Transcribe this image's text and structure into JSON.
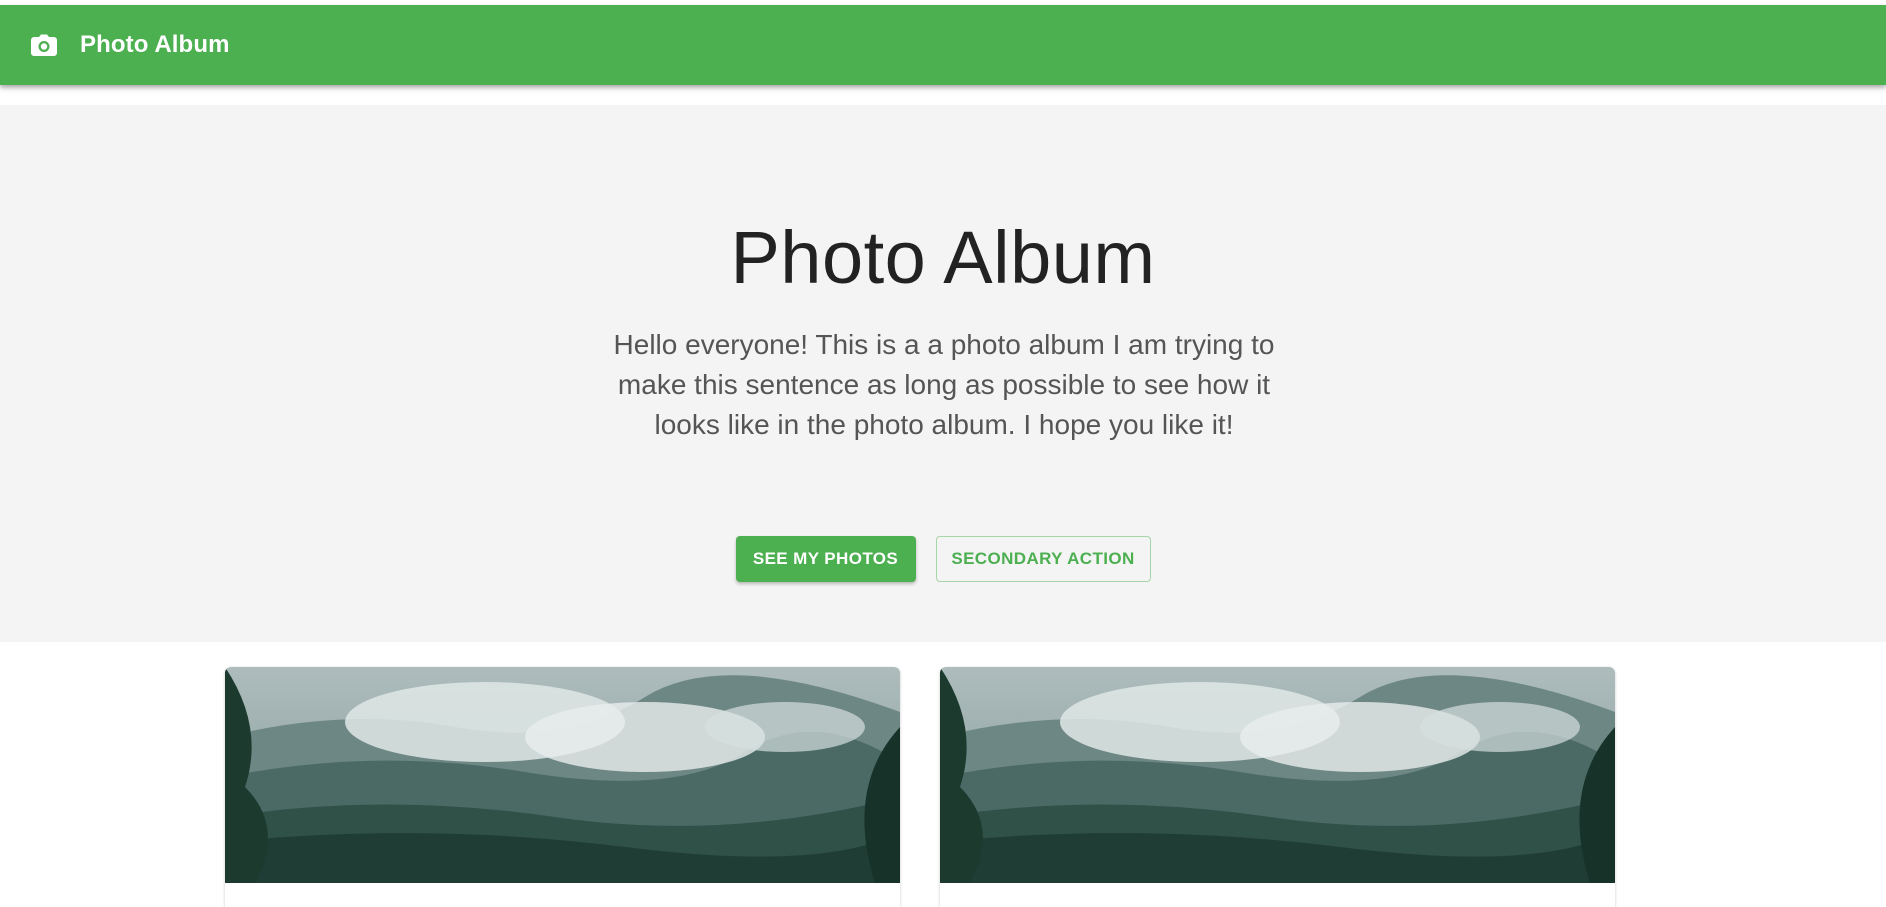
{
  "appbar": {
    "title": "Photo Album",
    "icon": "camera-icon",
    "background": "#4caf50"
  },
  "hero": {
    "heading": "Photo Album",
    "description": "Hello everyone! This is a a photo album I am trying to make this sentence as long as possible to see how it looks like in the photo album. I hope you like it!",
    "primary_button": "SEE MY PHOTOS",
    "secondary_button": "SECONDARY ACTION"
  },
  "cards": [
    {
      "image": "misty-forest-mountains"
    },
    {
      "image": "misty-forest-mountains"
    }
  ],
  "colors": {
    "accent": "#4caf50",
    "hero_bg": "#f4f4f4",
    "heading": "#222222",
    "body_text": "#555555"
  }
}
